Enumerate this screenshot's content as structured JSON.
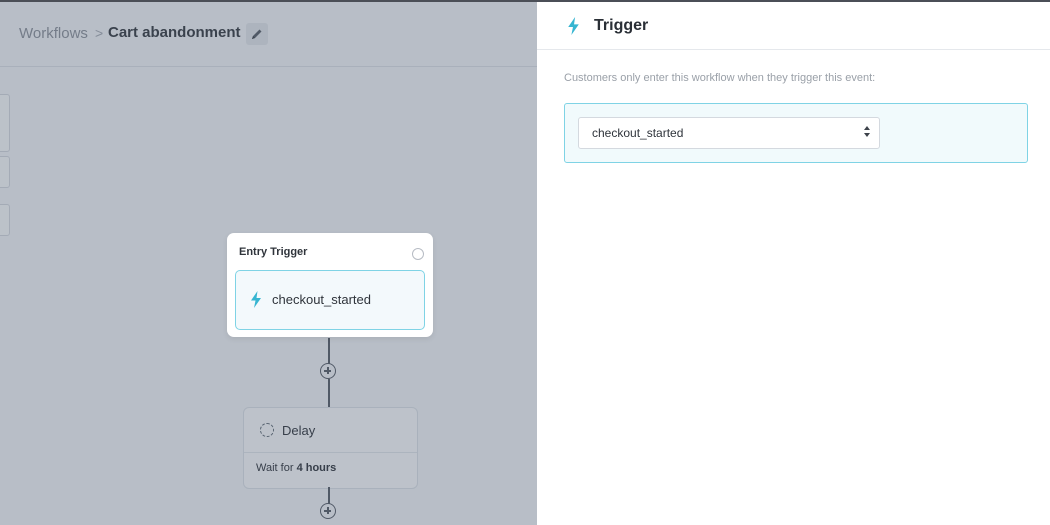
{
  "breadcrumb": {
    "root": "Workflows",
    "separator": ">",
    "current": "Cart abandonment"
  },
  "icons": {
    "edit": "pencil-icon",
    "trigger": "lightning-bolt-icon",
    "delay": "clock-dashed-icon",
    "add": "plus-circle-icon",
    "status": "settings-circle-icon"
  },
  "colors": {
    "accent": "#36b5d1",
    "accent_border": "#7fd3e5",
    "accent_bg": "#f1fafc"
  },
  "canvas": {
    "entry_trigger": {
      "title": "Entry Trigger",
      "event": "checkout_started"
    },
    "delay_step": {
      "title": "Delay",
      "detail_prefix": "Wait for",
      "detail_value": "4 hours"
    }
  },
  "panel": {
    "title": "Trigger",
    "description": "Customers only enter this workflow when they trigger this event:",
    "event_select": {
      "value": "checkout_started"
    }
  }
}
